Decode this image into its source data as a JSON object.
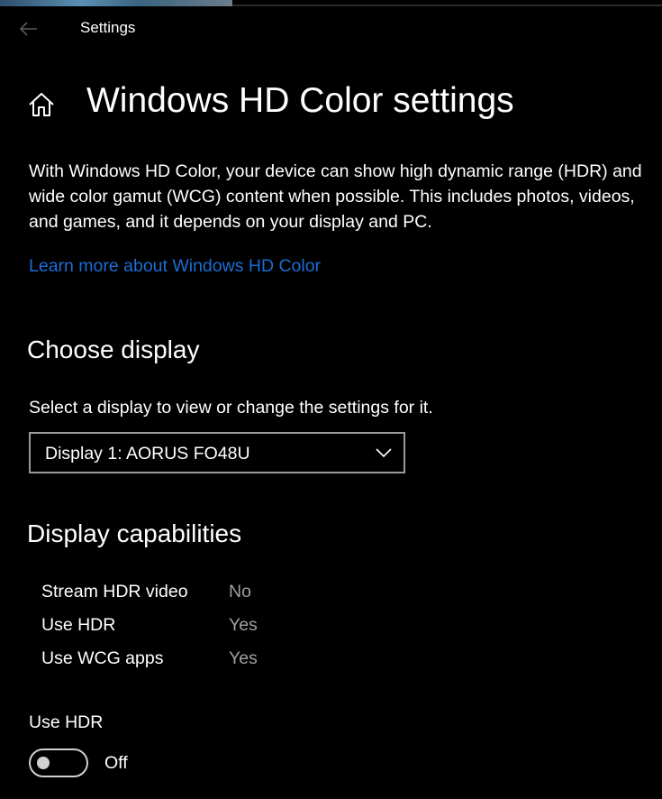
{
  "window": {
    "app_title": "Settings"
  },
  "header": {
    "page_title": "Windows HD Color settings"
  },
  "intro": {
    "description": "With Windows HD Color, your device can show high dynamic range (HDR) and wide color gamut (WCG) content when possible. This includes photos, videos, and games, and it depends on your display and PC.",
    "learn_more_link": "Learn more about Windows HD Color"
  },
  "choose_display": {
    "heading": "Choose display",
    "hint": "Select a display to view or change the settings for it.",
    "selected_display": "Display 1: AORUS FO48U"
  },
  "capabilities": {
    "heading": "Display capabilities",
    "rows": [
      {
        "label": "Stream HDR video",
        "value": "No"
      },
      {
        "label": "Use HDR",
        "value": "Yes"
      },
      {
        "label": "Use WCG apps",
        "value": "Yes"
      }
    ]
  },
  "hdr_toggle": {
    "label": "Use HDR",
    "state_text": "Off",
    "on": false
  },
  "colors": {
    "background": "#000000",
    "text": "#ffffff",
    "link": "#1c6dd6",
    "secondary_text": "#a0a0a0"
  },
  "icons": {
    "back": "back-arrow-icon",
    "home": "home-icon",
    "dropdown": "chevron-down-icon"
  }
}
